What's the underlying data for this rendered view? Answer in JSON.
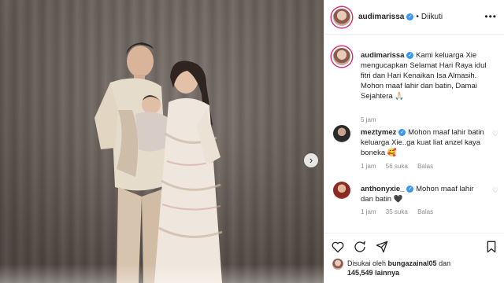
{
  "post": {
    "username": "audimarissa",
    "separator": "•",
    "follow_state": "Diikuti",
    "more": "•••"
  },
  "caption": {
    "username": "audimarissa",
    "text": "Kami keluarga Xie mengucapkan Selamat Hari Raya idul fitri dan Hari Kenaikan Isa Almasih. Mohon maaf lahir dan batin, Damai Sejahtera 🙏🏻",
    "time": "5 jam"
  },
  "comments": [
    {
      "username": "meztymez",
      "text": "Mohon maaf lahir batin keluarga Xie..ga kuat liat anzel kaya boneka 🥰",
      "time": "1 jam",
      "likes": "56 suka",
      "reply": "Balas"
    },
    {
      "username": "anthonyxie_",
      "text": "Mohon maaf lahir dan batin 🖤",
      "time": "1 jam",
      "likes": "35 suka",
      "reply": "Balas"
    }
  ],
  "likes": {
    "prefix": "Disukai oleh",
    "user": "bungazainal05",
    "conj": "dan",
    "count": "145,549",
    "suffix": "lainnya"
  },
  "icons": [
    "heart-icon",
    "comment-icon",
    "share-icon",
    "bookmark-icon",
    "verified-badge-icon",
    "chevron-right-icon"
  ],
  "colors": {
    "verified": "#3897f0",
    "story_ring": "#d62976",
    "muted": "#8e8e8e"
  }
}
